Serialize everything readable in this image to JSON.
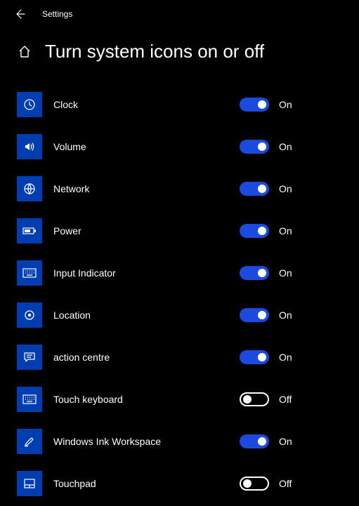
{
  "header": {
    "app": "Settings"
  },
  "page": {
    "title": "Turn system icons on or off"
  },
  "state_labels": {
    "on": "On",
    "off": "Off"
  },
  "items": [
    {
      "id": "clock",
      "label": "Clock",
      "icon": "clock-icon",
      "on": true
    },
    {
      "id": "volume",
      "label": "Volume",
      "icon": "volume-icon",
      "on": true
    },
    {
      "id": "network",
      "label": "Network",
      "icon": "globe-icon",
      "on": true
    },
    {
      "id": "power",
      "label": "Power",
      "icon": "battery-icon",
      "on": true
    },
    {
      "id": "input",
      "label": "Input Indicator",
      "icon": "keyboard-icon",
      "on": true
    },
    {
      "id": "location",
      "label": "Location",
      "icon": "location-icon",
      "on": true
    },
    {
      "id": "action",
      "label": "action centre",
      "icon": "message-icon",
      "on": true
    },
    {
      "id": "touchkb",
      "label": "Touch keyboard",
      "icon": "touchkb-icon",
      "on": false
    },
    {
      "id": "ink",
      "label": "Windows Ink Workspace",
      "icon": "pen-icon",
      "on": true
    },
    {
      "id": "touchpad",
      "label": "Touchpad",
      "icon": "touchpad-icon",
      "on": false
    }
  ]
}
